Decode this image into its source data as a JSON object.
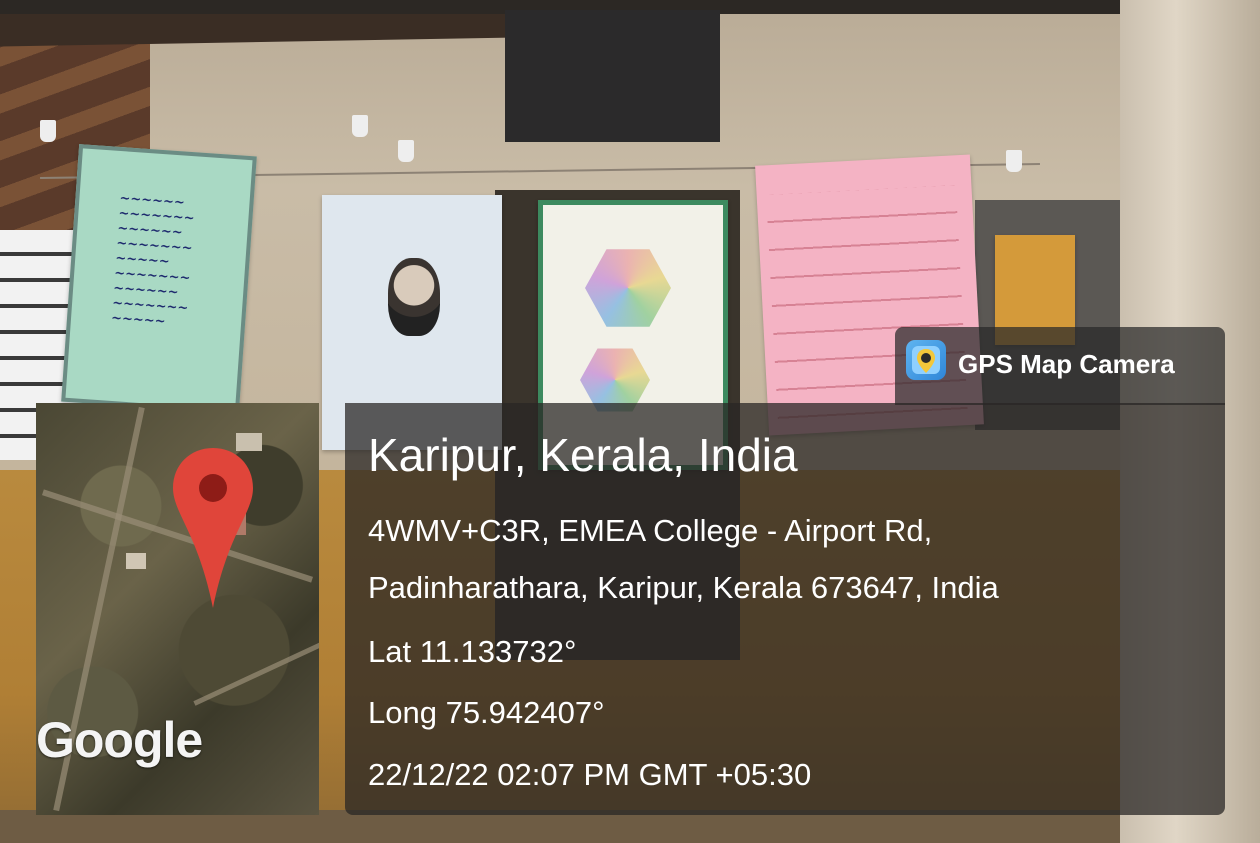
{
  "app": {
    "name": "GPS Map Camera",
    "icon": "gps-map-camera-app-icon"
  },
  "map": {
    "attribution": "Google",
    "marker_icon": "map-pin-icon",
    "marker_color": "#e0453a"
  },
  "location": {
    "title": "Karipur, Kerala, India",
    "address_line1": "4WMV+C3R, EMEA College - Airport Rd,",
    "address_line2": "Padinharathara, Karipur, Kerala 673647, India",
    "latitude": "Lat 11.133732°",
    "longitude": "Long 75.942407°",
    "datetime": "22/12/22 02:07 PM GMT +05:30"
  }
}
